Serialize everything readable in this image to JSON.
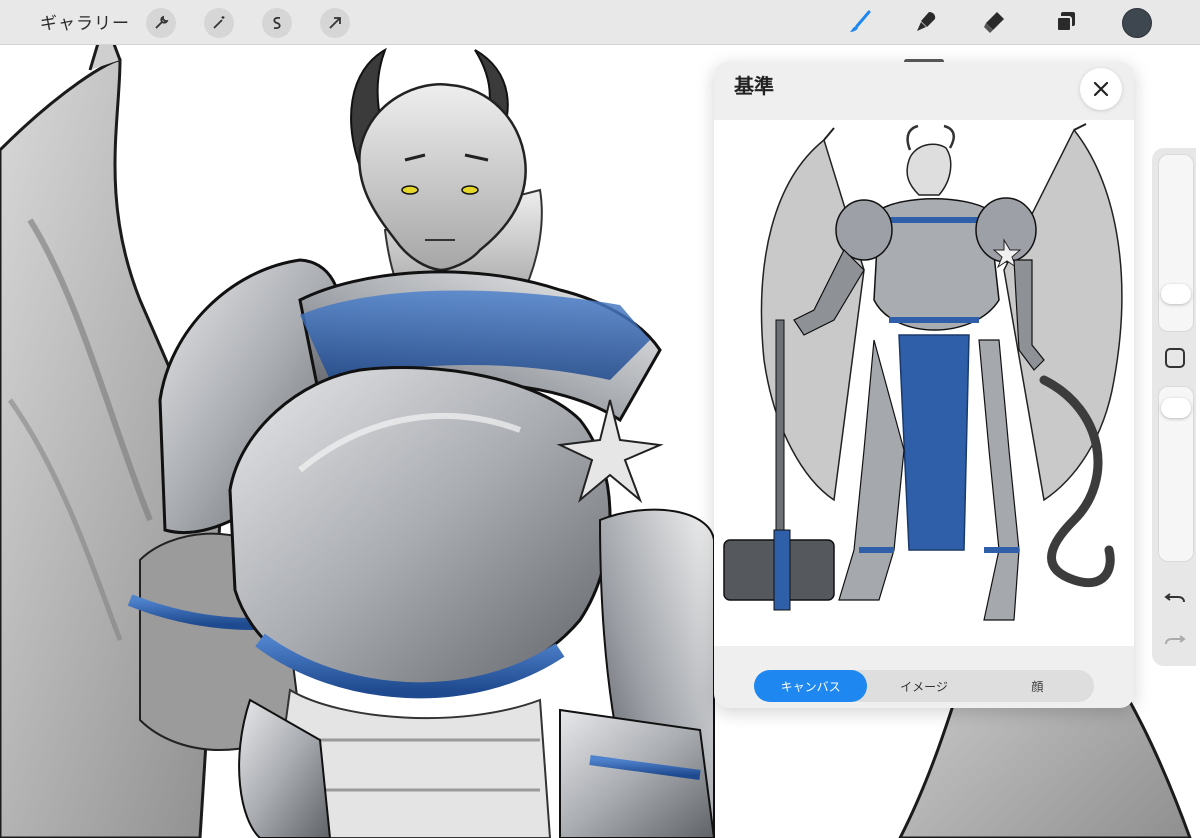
{
  "topbar": {
    "gallery_label": "ギャラリー",
    "left_tools": [
      "wrench-icon",
      "magic-wand-icon",
      "selection-icon",
      "transform-arrow-icon"
    ],
    "right_tools": [
      "brush-icon",
      "smudge-icon",
      "eraser-icon",
      "layers-icon",
      "color-swatch"
    ],
    "active_tool": "brush-icon",
    "accent_color": "#1e88f0",
    "current_color": "#3e4650"
  },
  "reference": {
    "title": "基準",
    "tabs": [
      {
        "label": "キャンバス",
        "active": true
      },
      {
        "label": "イメージ",
        "active": false
      },
      {
        "label": "顔",
        "active": false
      }
    ]
  },
  "sidebar": {
    "controls": [
      "brush-size-slider",
      "modify-button",
      "opacity-slider",
      "undo-icon",
      "redo-icon"
    ]
  },
  "colors": {
    "armor_blue": "#2e5fa8",
    "armor_silver": "#b9bcc0",
    "panel_bg": "#efefef"
  }
}
